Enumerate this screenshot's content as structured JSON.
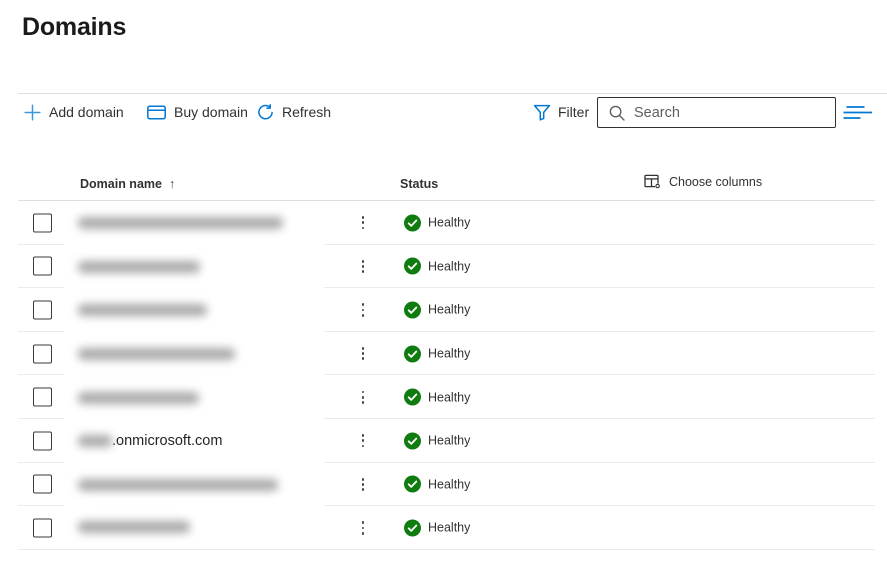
{
  "page": {
    "title": "Domains"
  },
  "toolbar": {
    "add_domain_label": "Add domain",
    "buy_domain_label": "Buy domain",
    "refresh_label": "Refresh",
    "filter_label": "Filter",
    "search_placeholder": "Search"
  },
  "icons": {
    "add": "plus-icon",
    "buy": "credit-card-icon",
    "refresh": "refresh-icon",
    "filter": "funnel-icon",
    "search": "magnifier-icon",
    "view_options": "horizontal-lines-icon",
    "choose_columns": "table-gear-icon",
    "sort": "arrow-up-icon",
    "row_menu": "vertical-ellipsis-icon",
    "status_ok": "check-circle-icon"
  },
  "table": {
    "header": {
      "domain_column": "Domain name",
      "sort_indicator": "↑",
      "status_column": "Status",
      "choose_columns_label": "Choose columns"
    },
    "rows": [
      {
        "domain_redacted": true,
        "redacted_width": 205,
        "domain_visible_text": "",
        "status": "Healthy"
      },
      {
        "domain_redacted": true,
        "redacted_width": 122,
        "domain_visible_text": "",
        "status": "Healthy"
      },
      {
        "domain_redacted": true,
        "redacted_width": 129,
        "domain_visible_text": "",
        "status": "Healthy"
      },
      {
        "domain_redacted": true,
        "redacted_width": 157,
        "domain_visible_text": "",
        "status": "Healthy"
      },
      {
        "domain_redacted": true,
        "redacted_width": 121,
        "domain_visible_text": "",
        "status": "Healthy"
      },
      {
        "domain_redacted": true,
        "redacted_width": 34,
        "domain_visible_text": ".onmicrosoft.com",
        "status": "Healthy"
      },
      {
        "domain_redacted": true,
        "redacted_width": 200,
        "domain_visible_text": "",
        "status": "Healthy"
      },
      {
        "domain_redacted": true,
        "redacted_width": 112,
        "domain_visible_text": "",
        "status": "Healthy"
      }
    ]
  },
  "colors": {
    "accent": "#0078d4",
    "healthy_green": "#107c10",
    "text": "#323130",
    "secondary_text": "#605e5c",
    "divider": "#edebe9"
  }
}
